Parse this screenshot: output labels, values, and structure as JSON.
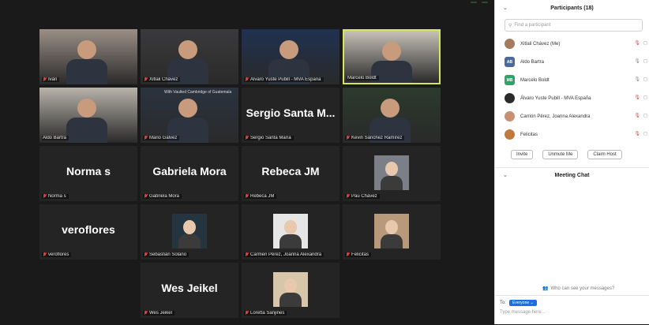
{
  "header": {
    "badge_left": "",
    "badge_right": ""
  },
  "tiles": [
    {
      "label": "Iván",
      "muted": true,
      "video": true,
      "bg": "#9a8f86"
    },
    {
      "label": "Xitlali Chávez",
      "muted": true,
      "video": true,
      "bg": "#3a3a3c"
    },
    {
      "label": "Álvaro Yuste Pubill - MVA España",
      "muted": true,
      "video": true,
      "bg": "#1f3150"
    },
    {
      "label": "Marcelo Boldt",
      "muted": false,
      "video": true,
      "bg": "#c7c2b8",
      "active": true
    },
    {
      "label": "Aldo Bartra",
      "muted": false,
      "video": true,
      "bg": "#b8b3aa"
    },
    {
      "label": "Mario Gálvez",
      "muted": true,
      "video": true,
      "bg": "#2a3340",
      "overlay": "With Vaulted Cambridge of Guatemala"
    },
    {
      "label": "Sergio Santa María",
      "muted": true,
      "video": false,
      "bigname": "Sergio Santa M..."
    },
    {
      "label": "Kevin Sánchez Ramírez",
      "muted": true,
      "video": true,
      "bg": "#2b3a2c"
    },
    {
      "label": "Norma s",
      "muted": true,
      "video": false,
      "bigname": "Norma s"
    },
    {
      "label": "Gabriela Mora",
      "muted": true,
      "video": false,
      "bigname": "Gabriela Mora"
    },
    {
      "label": "Rebeca JM",
      "muted": true,
      "video": false,
      "bigname": "Rebeca JM"
    },
    {
      "label": "Pau Chávez",
      "muted": true,
      "video": false,
      "thumb": true,
      "thumb_bg": "#7a7f88"
    },
    {
      "label": "veroflores",
      "muted": true,
      "video": false,
      "bigname": "veroflores"
    },
    {
      "label": "Sebastián Solano",
      "muted": true,
      "video": false,
      "thumb": true,
      "thumb_bg": "#24353f"
    },
    {
      "label": "Carmen Pérez, Joanna Alexandra",
      "muted": true,
      "video": false,
      "thumb": true,
      "thumb_bg": "#e6e6e6"
    },
    {
      "label": "Felicitas",
      "muted": true,
      "video": false,
      "thumb": true,
      "thumb_bg": "#b89a7b"
    },
    {
      "label": "Wes Jeikel",
      "muted": true,
      "video": false,
      "bigname": "Wes Jeikel"
    },
    {
      "label": "Loretta Sanjines",
      "muted": true,
      "video": false,
      "thumb": true,
      "thumb_bg": "#d8c6aa"
    }
  ],
  "sidebar": {
    "title": "Participants (18)",
    "search_placeholder": "Find a participant",
    "participants": [
      {
        "name": "Xitlali Chávez (Me)",
        "avatar_type": "photo",
        "color": "#a47b5c",
        "initials": ""
      },
      {
        "name": "Aldo Bartra",
        "avatar_type": "initials",
        "color": "#4a6a9a",
        "initials": "AB"
      },
      {
        "name": "Marcelo Boldt",
        "avatar_type": "initials",
        "color": "#2aa66a",
        "initials": "MB"
      },
      {
        "name": "Álvaro Yuste Pubill - MVA España",
        "avatar_type": "photo",
        "color": "#2b2b2b",
        "initials": ""
      },
      {
        "name": "Carrión Pérez, Joanna Alexandra",
        "avatar_type": "photo",
        "color": "#c98f72",
        "initials": ""
      },
      {
        "name": "Felicitas",
        "avatar_type": "photo",
        "color": "#c07a3e",
        "initials": ""
      }
    ],
    "buttons": {
      "invite": "Invite",
      "unmute": "Unmute Me",
      "claim": "Claim Host"
    }
  },
  "chat": {
    "title": "Meeting Chat",
    "who_can_see": "Who can see your messages?",
    "to_label": "To:",
    "recipient": "Everyone",
    "input_placeholder": "Type message here..."
  }
}
